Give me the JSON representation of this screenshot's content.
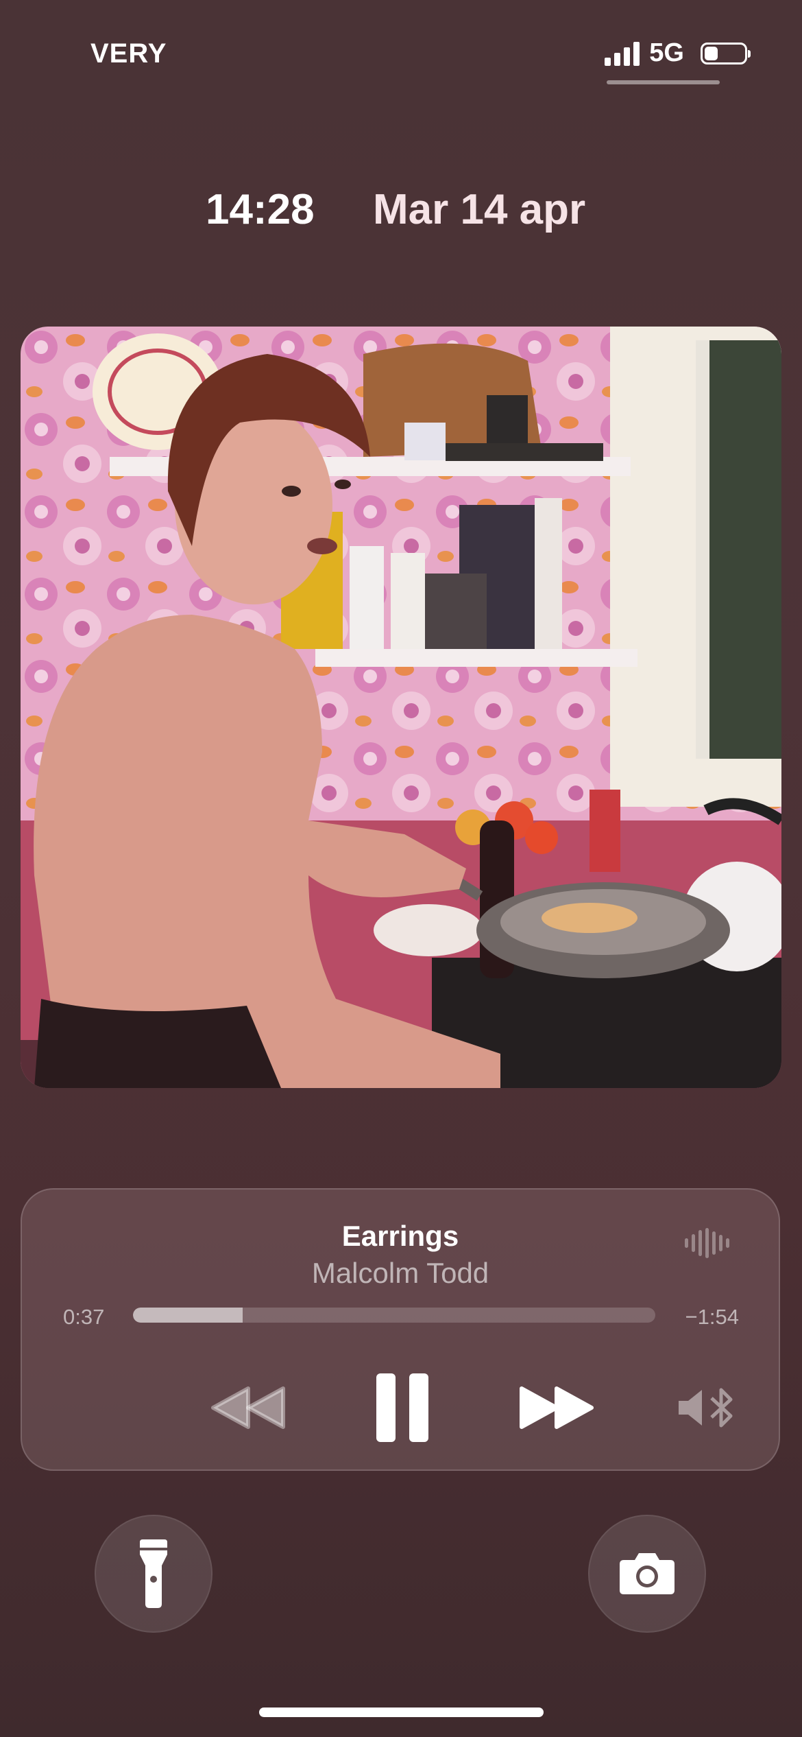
{
  "status_bar": {
    "carrier": "VERY",
    "network": "5G",
    "signal_bars": 4
  },
  "lock": {
    "time": "14:28",
    "date": "Mar 14 apr"
  },
  "now_playing": {
    "title": "Earrings",
    "artist": "Malcolm Todd",
    "elapsed": "0:37",
    "remaining": "−1:54",
    "progress": 0.21
  },
  "icons": {
    "waveform": "waveform-icon",
    "rewind": "rewind-icon",
    "pause": "pause-icon",
    "fast_forward": "fast-forward-icon",
    "output": "speaker-bluetooth-icon",
    "flashlight": "flashlight-icon",
    "camera": "camera-icon"
  },
  "colors": {
    "background": "#4a3336",
    "card": "#6b5558",
    "date_text": "#f6e3e6"
  }
}
